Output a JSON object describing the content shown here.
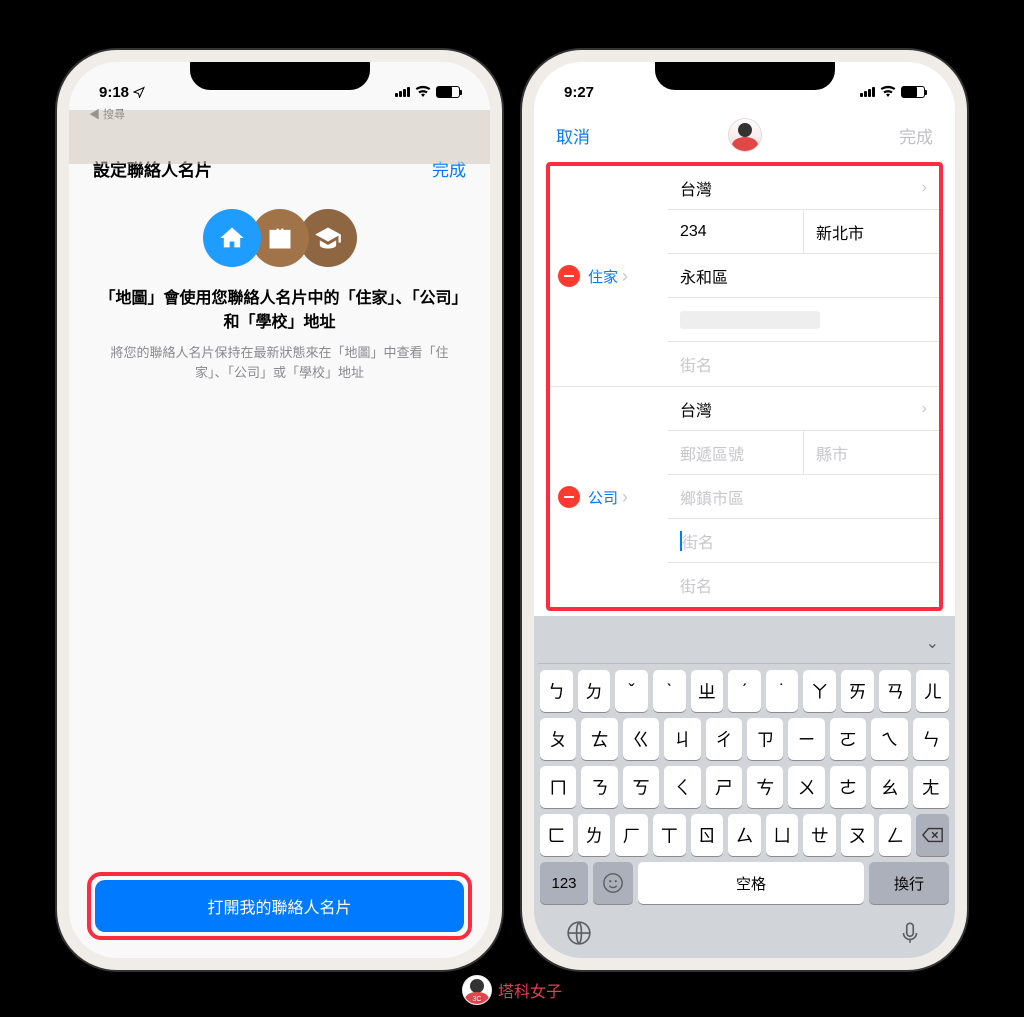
{
  "phone1": {
    "status": {
      "time": "9:18",
      "back_search": "◀ 搜尋"
    },
    "nav": {
      "title": "設定聯絡人名片",
      "done": "完成"
    },
    "heading": "「地圖」會使用您聯絡人名片中的「住家」、「公司」和「學校」地址",
    "subtext": "將您的聯絡人名片保持在最新狀態來在「地圖」中查看「住家」、「公司」或「學校」地址",
    "button": "打開我的聯絡人名片"
  },
  "phone2": {
    "status": {
      "time": "9:27"
    },
    "nav": {
      "cancel": "取消",
      "done": "完成"
    },
    "home": {
      "label": "住家",
      "country": "台灣",
      "zip": "234",
      "city": "新北市",
      "district": "永和區",
      "street_ph": "街名"
    },
    "work": {
      "label": "公司",
      "country": "台灣",
      "zip_ph": "郵遞區號",
      "city_ph": "縣市",
      "district_ph": "鄉鎮市區",
      "street1_ph": "街名",
      "street2_ph": "街名"
    },
    "keyboard": {
      "row1": [
        "ㄅ",
        "ㄉ",
        "ˇ",
        "ˋ",
        "ㄓ",
        "ˊ",
        "˙",
        "ㄚ",
        "ㄞ",
        "ㄢ",
        "ㄦ"
      ],
      "row2": [
        "ㄆ",
        "ㄊ",
        "ㄍ",
        "ㄐ",
        "ㄔ",
        "ㄗ",
        "ㄧ",
        "ㄛ",
        "ㄟ",
        "ㄣ"
      ],
      "row3": [
        "ㄇ",
        "ㄋ",
        "ㄎ",
        "ㄑ",
        "ㄕ",
        "ㄘ",
        "ㄨ",
        "ㄜ",
        "ㄠ",
        "ㄤ"
      ],
      "row4": [
        "ㄈ",
        "ㄌ",
        "ㄏ",
        "ㄒ",
        "ㄖ",
        "ㄙ",
        "ㄩ",
        "ㄝ",
        "ㄡ",
        "ㄥ"
      ],
      "k123": "123",
      "space": "空格",
      "return": "換行"
    }
  },
  "watermark": "塔科女子"
}
